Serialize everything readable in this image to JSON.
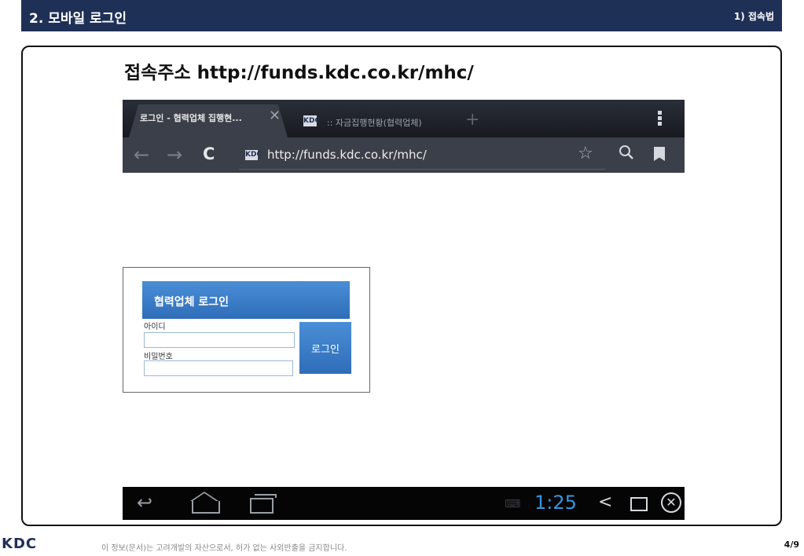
{
  "header": {
    "title": "2. 모바일 로그인",
    "section": "1) 접속법"
  },
  "heading": "접속주소 http://funds.kdc.co.kr/mhc/",
  "browser": {
    "tabs": [
      {
        "label": "로그인 - 협력업체 집행현...",
        "active": true
      },
      {
        "label": ":: 자금집행현황(협력업체)",
        "active": false
      }
    ],
    "new_tab_symbol": "+",
    "close_symbol": "✕",
    "address": "http://funds.kdc.co.kr/mhc/",
    "icons": {
      "back": "arrow-left-icon",
      "forward": "arrow-right-icon",
      "reload": "reload-icon",
      "star": "star-icon",
      "search": "search-icon",
      "bookmarks": "bookmark-icon",
      "menu": "overflow-menu-icon"
    }
  },
  "login": {
    "title": "협력업체 로그인",
    "id_label": "아이디",
    "password_label": "비밀번호",
    "button": "로그인",
    "id_value": "",
    "password_value": ""
  },
  "system_bar": {
    "time": "1:25",
    "icons": [
      "back-icon",
      "home-icon",
      "recent-apps-icon",
      "keyboard-icon",
      "share-icon",
      "window-icon",
      "close-circle-icon"
    ]
  },
  "footer": {
    "logo": "KDC",
    "note": "이 정보(문서)는 고려개발의 자산으로서, 허가 없는 사외반출을 금지합니다.",
    "page": "4/9"
  },
  "colors": {
    "header_bg": "#1f3057",
    "login_blue": "#3a7cc6",
    "clock_blue": "#3596e0"
  }
}
